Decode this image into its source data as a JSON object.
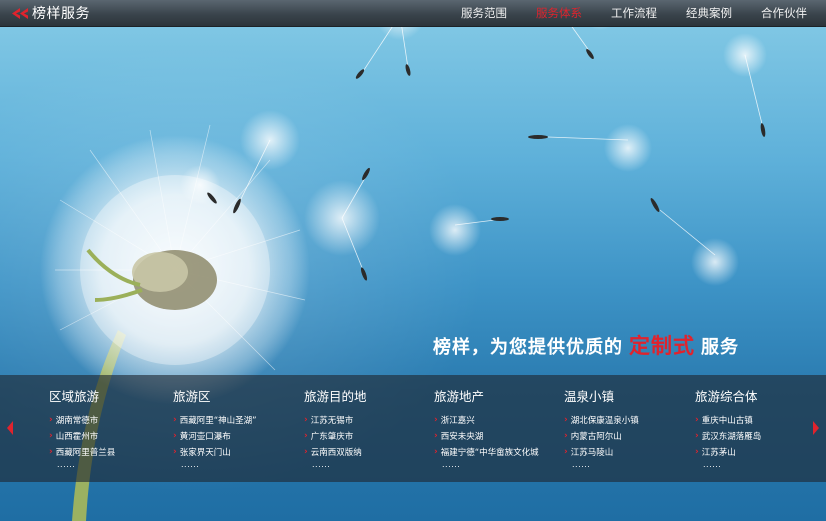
{
  "brand": {
    "name": "榜样服务",
    "logo_icon": "double-chevron-left-icon",
    "accent": "#e0232d"
  },
  "nav": [
    {
      "label": "服务范围",
      "active": false
    },
    {
      "label": "服务体系",
      "active": true
    },
    {
      "label": "工作流程",
      "active": false
    },
    {
      "label": "经典案例",
      "active": false
    },
    {
      "label": "合作伙伴",
      "active": false
    }
  ],
  "slogan": {
    "part1": "榜样，为您提供优质的",
    "highlight": "定制式",
    "part2": "服务"
  },
  "categories": [
    {
      "title": "区域旅游",
      "items": [
        "湖南常德市",
        "山西霍州市",
        "西藏阿里普兰县"
      ],
      "more": "......"
    },
    {
      "title": "旅游区",
      "items": [
        "西藏阿里“神山圣湖”",
        "黄河壶口瀑布",
        "张家界天门山"
      ],
      "more": "......"
    },
    {
      "title": "旅游目的地",
      "items": [
        "江苏无锡市",
        "广东肇庆市",
        "云南西双版纳"
      ],
      "more": "......"
    },
    {
      "title": "旅游地产",
      "items": [
        "浙江嘉兴",
        "西安未央湖",
        "福建宁德“中华畲族文化城"
      ],
      "more": "......"
    },
    {
      "title": "温泉小镇",
      "items": [
        "湖北保康温泉小镇",
        "内蒙古阿尔山",
        "江苏马陵山"
      ],
      "more": "......"
    },
    {
      "title": "旅游综合体",
      "items": [
        "重庆中山古镇",
        "武汉东湖落雁岛",
        "江苏茅山"
      ],
      "more": "......"
    }
  ],
  "carousel": {
    "prev_icon": "arrow-left-icon",
    "next_icon": "arrow-right-icon"
  }
}
